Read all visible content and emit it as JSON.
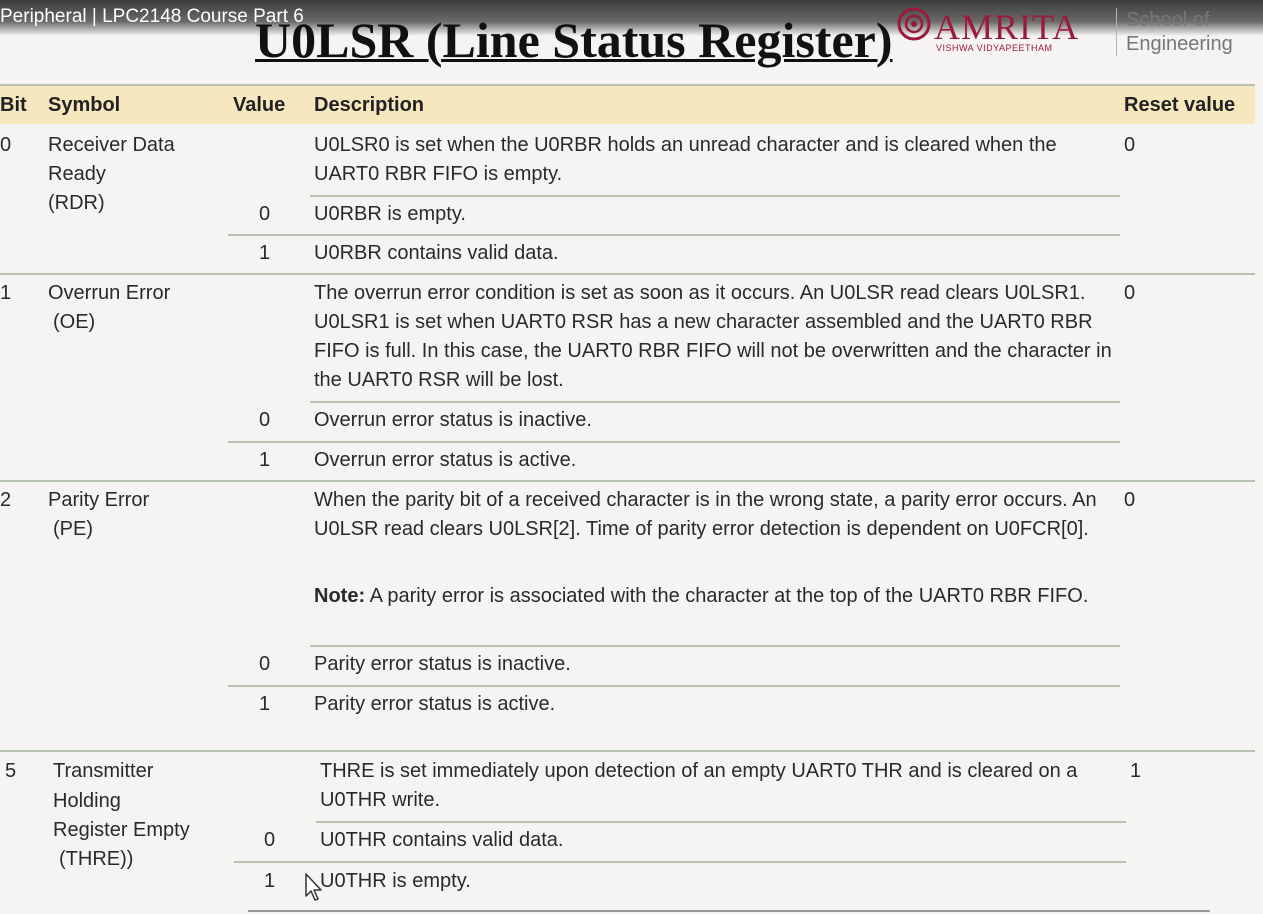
{
  "video": {
    "title": "Peripheral | LPC2148 Course Part 6"
  },
  "slide": {
    "title": "U0LSR (Line Status Register)"
  },
  "logo": {
    "wordmark": "AMRITA",
    "subtext": "VISHWA VIDYAPEETHAM",
    "school_line1": "School of",
    "school_line2": "Engineering",
    "brand_color": "#9b1a3c"
  },
  "table": {
    "headers": {
      "bit": "Bit",
      "symbol": "Symbol",
      "value": "Value",
      "description": "Description",
      "reset": "Reset value"
    },
    "rows": [
      {
        "bit": "0",
        "symbol": [
          "Receiver Data",
          "Ready",
          "(RDR)"
        ],
        "description": "U0LSR0 is set when the U0RBR holds an unread character and is cleared when the UART0 RBR FIFO is empty.",
        "reset": "0",
        "values": [
          {
            "value": "0",
            "text": "U0RBR is empty."
          },
          {
            "value": "1",
            "text": "U0RBR contains valid data."
          }
        ]
      },
      {
        "bit": "1",
        "symbol": [
          "Overrun Error",
          "(OE)"
        ],
        "description": "The overrun error condition is set as soon as it occurs. An U0LSR read clears U0LSR1. U0LSR1 is set when UART0 RSR has a new character assembled and the UART0 RBR FIFO is full. In this case, the UART0 RBR FIFO will not be overwritten and the character in the UART0 RSR will be lost.",
        "reset": "0",
        "values": [
          {
            "value": "0",
            "text": "Overrun error status is inactive."
          },
          {
            "value": "1",
            "text": "Overrun error status is active."
          }
        ]
      },
      {
        "bit": "2",
        "symbol": [
          "Parity Error",
          "(PE)"
        ],
        "description": "When the parity bit of a received character is in the wrong state, a parity error occurs. An U0LSR read clears U0LSR[2]. Time of parity error detection is dependent on U0FCR[0].",
        "note_label": "Note:",
        "note_text": " A parity error is associated with the character at the top of the UART0 RBR FIFO.",
        "reset": "0",
        "values": [
          {
            "value": "0",
            "text": "Parity error status is inactive."
          },
          {
            "value": "1",
            "text": "Parity error status is active."
          }
        ]
      },
      {
        "bit": "5",
        "symbol": [
          "Transmitter",
          "Holding",
          "Register Empty",
          "(THRE))"
        ],
        "description": "THRE is set immediately upon detection of an empty UART0 THR and is cleared on a U0THR write.",
        "reset": "1",
        "values": [
          {
            "value": "0",
            "text": "U0THR contains valid data."
          },
          {
            "value": "1",
            "text": "U0THR is empty."
          }
        ]
      }
    ]
  }
}
